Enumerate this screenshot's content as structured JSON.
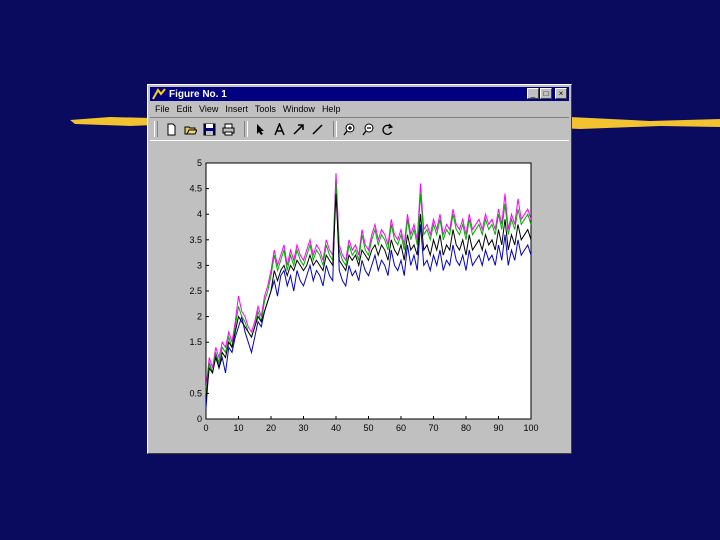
{
  "window": {
    "title": "Figure No. 1",
    "title_buttons": [
      "_",
      "□",
      "×"
    ]
  },
  "menu": [
    "File",
    "Edit",
    "View",
    "Insert",
    "Tools",
    "Window",
    "Help"
  ],
  "toolbar": {
    "tools": [
      "new-file-icon",
      "open-file-icon",
      "save-icon",
      "print-icon",
      "edit-plot-arrow-icon",
      "insert-text-icon",
      "insert-arrow-icon",
      "insert-line-icon",
      "zoom-in-icon",
      "zoom-out-icon",
      "rotate-icon"
    ]
  },
  "colors": {
    "background": "#0a0a5e",
    "brush": "#f2c230",
    "series": [
      "#0000c8",
      "#ff00ff",
      "#00b000",
      "#000000"
    ]
  },
  "chart_data": {
    "type": "line",
    "xlim": [
      0,
      100
    ],
    "ylim": [
      0,
      5
    ],
    "x_ticks": [
      "0",
      "10",
      "20",
      "30",
      "40",
      "50",
      "60",
      "70",
      "80",
      "90",
      "100"
    ],
    "y_ticks": [
      "0",
      "0.5",
      "1.5",
      "2",
      "2.5",
      "3",
      "3.5",
      "4",
      "4.5",
      "5"
    ],
    "y_tick_values": [
      0,
      0.5,
      1.5,
      2,
      2.5,
      3,
      3.5,
      4,
      4.5,
      5
    ],
    "grid": false,
    "series": [
      {
        "color": "#0000c8",
        "values": [
          0.2,
          1.1,
          0.9,
          1.3,
          1.0,
          1.2,
          0.9,
          1.4,
          1.3,
          1.6,
          1.8,
          2.0,
          1.7,
          1.5,
          1.3,
          1.6,
          1.9,
          1.8,
          2.1,
          2.3,
          2.5,
          2.7,
          2.4,
          2.8,
          2.9,
          2.6,
          2.8,
          2.5,
          2.9,
          2.7,
          2.6,
          2.8,
          3.0,
          2.7,
          2.9,
          2.8,
          2.6,
          3.0,
          2.8,
          2.7,
          4.7,
          2.9,
          2.7,
          2.6,
          3.0,
          2.8,
          2.9,
          2.7,
          3.1,
          2.9,
          2.8,
          3.0,
          3.2,
          2.9,
          3.1,
          3.0,
          2.8,
          3.3,
          3.0,
          2.9,
          3.1,
          2.8,
          3.4,
          3.0,
          3.2,
          2.9,
          3.8,
          3.0,
          3.1,
          2.9,
          3.2,
          3.0,
          3.3,
          2.9,
          3.1,
          3.0,
          3.4,
          3.1,
          3.0,
          3.2,
          2.9,
          3.3,
          3.0,
          3.1,
          3.2,
          3.0,
          3.3,
          3.1,
          3.2,
          3.0,
          3.4,
          3.1,
          3.6,
          3.0,
          3.3,
          3.1,
          3.5,
          3.2,
          3.3,
          3.4,
          3.2
        ]
      },
      {
        "color": "#ff00ff",
        "values": [
          0.6,
          1.2,
          1.0,
          1.4,
          1.2,
          1.5,
          1.4,
          1.7,
          1.5,
          1.9,
          2.4,
          2.1,
          2.0,
          1.8,
          1.7,
          1.9,
          2.2,
          2.0,
          2.4,
          2.6,
          2.9,
          3.3,
          3.0,
          3.2,
          3.4,
          3.0,
          3.3,
          3.1,
          3.4,
          3.2,
          3.1,
          3.3,
          3.5,
          3.2,
          3.4,
          3.3,
          3.1,
          3.5,
          3.3,
          3.2,
          4.8,
          3.4,
          3.2,
          3.1,
          3.5,
          3.3,
          3.4,
          3.2,
          3.7,
          3.4,
          3.3,
          3.6,
          3.8,
          3.5,
          3.7,
          3.6,
          3.4,
          3.9,
          3.6,
          3.5,
          3.7,
          3.4,
          4.0,
          3.6,
          3.8,
          3.5,
          4.6,
          3.7,
          3.8,
          3.6,
          3.9,
          3.7,
          4.0,
          3.6,
          3.8,
          3.7,
          4.1,
          3.8,
          3.7,
          3.9,
          3.6,
          4.0,
          3.7,
          3.8,
          3.9,
          3.7,
          4.0,
          3.8,
          3.9,
          3.7,
          4.1,
          3.8,
          4.4,
          3.7,
          4.0,
          3.8,
          4.3,
          3.9,
          4.0,
          4.1,
          3.9
        ]
      },
      {
        "color": "#00b000",
        "values": [
          0.5,
          1.1,
          0.9,
          1.3,
          1.1,
          1.4,
          1.3,
          1.6,
          1.4,
          1.8,
          2.2,
          2.0,
          1.9,
          1.7,
          1.6,
          1.8,
          2.1,
          1.9,
          2.3,
          2.5,
          2.8,
          3.2,
          2.9,
          3.1,
          3.3,
          2.9,
          3.2,
          3.0,
          3.3,
          3.1,
          3.0,
          3.2,
          3.4,
          3.1,
          3.3,
          3.2,
          3.0,
          3.4,
          3.2,
          3.1,
          4.6,
          3.3,
          3.1,
          3.0,
          3.4,
          3.2,
          3.3,
          3.1,
          3.6,
          3.3,
          3.2,
          3.5,
          3.7,
          3.4,
          3.6,
          3.5,
          3.3,
          3.8,
          3.5,
          3.4,
          3.6,
          3.3,
          3.9,
          3.5,
          3.7,
          3.4,
          4.4,
          3.6,
          3.7,
          3.5,
          3.8,
          3.6,
          3.9,
          3.5,
          3.7,
          3.6,
          4.0,
          3.7,
          3.6,
          3.8,
          3.5,
          3.9,
          3.6,
          3.7,
          3.8,
          3.6,
          3.9,
          3.7,
          3.8,
          3.6,
          4.0,
          3.7,
          4.2,
          3.6,
          3.9,
          3.7,
          4.1,
          3.8,
          3.9,
          4.0,
          3.8
        ]
      },
      {
        "color": "#000000",
        "values": [
          0.4,
          1.0,
          0.9,
          1.2,
          1.0,
          1.3,
          1.2,
          1.5,
          1.4,
          1.7,
          2.0,
          1.9,
          1.8,
          1.7,
          1.6,
          1.8,
          2.0,
          1.9,
          2.1,
          2.3,
          2.5,
          2.9,
          2.7,
          2.9,
          3.0,
          2.8,
          3.0,
          2.9,
          3.1,
          3.0,
          2.9,
          3.0,
          3.2,
          3.0,
          3.1,
          3.0,
          2.9,
          3.2,
          3.1,
          3.0,
          4.4,
          3.1,
          3.0,
          2.9,
          3.2,
          3.1,
          3.2,
          3.0,
          3.3,
          3.2,
          3.1,
          3.3,
          3.4,
          3.2,
          3.4,
          3.3,
          3.1,
          3.5,
          3.3,
          3.2,
          3.4,
          3.1,
          3.6,
          3.3,
          3.4,
          3.2,
          4.0,
          3.3,
          3.4,
          3.2,
          3.5,
          3.3,
          3.6,
          3.2,
          3.4,
          3.3,
          3.7,
          3.4,
          3.3,
          3.5,
          3.2,
          3.6,
          3.3,
          3.4,
          3.5,
          3.3,
          3.6,
          3.4,
          3.5,
          3.3,
          3.7,
          3.4,
          3.9,
          3.3,
          3.6,
          3.4,
          3.8,
          3.5,
          3.6,
          3.7,
          3.5
        ]
      }
    ]
  }
}
